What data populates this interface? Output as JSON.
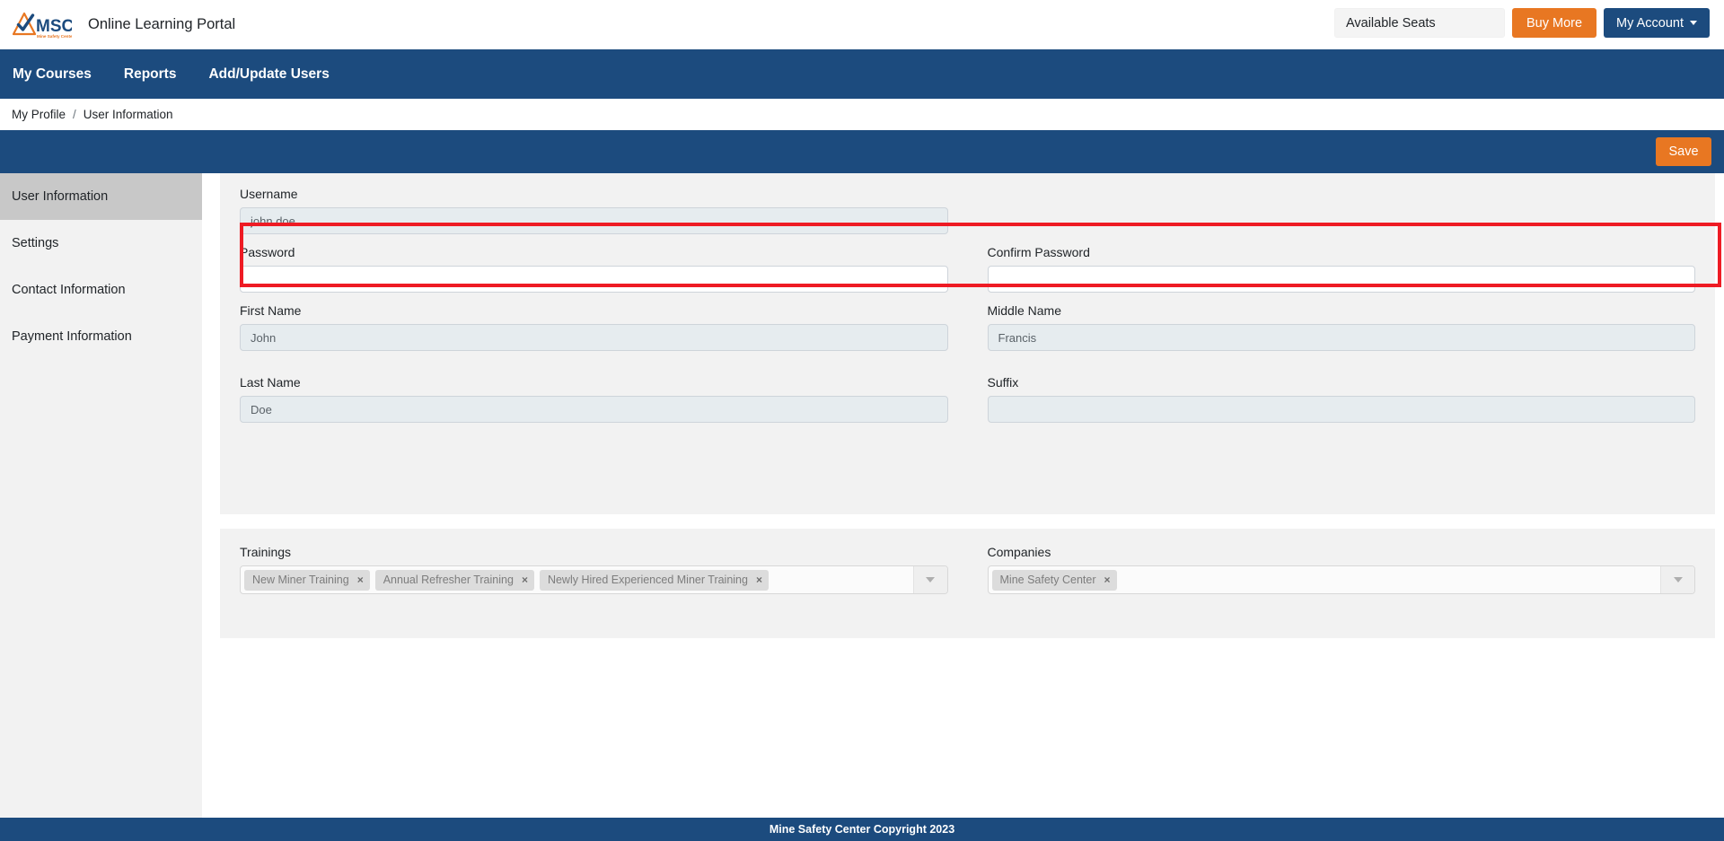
{
  "header": {
    "logo_text": "MSC",
    "logo_subtext": "Mine Safety Center",
    "logo_icon": "msc-triangle-check-logo",
    "app_title": "Online Learning Portal",
    "available_seats_label": "Available Seats",
    "buy_more_label": "Buy More",
    "my_account_label": "My Account",
    "caret_icon": "chevron-down-icon"
  },
  "nav": {
    "items": [
      {
        "label": "My Courses"
      },
      {
        "label": "Reports"
      },
      {
        "label": "Add/Update Users"
      }
    ]
  },
  "breadcrumb": {
    "parent": "My Profile",
    "separator": "/",
    "current": "User Information"
  },
  "action_bar": {
    "save_label": "Save"
  },
  "sidebar": {
    "items": [
      {
        "label": "User Information",
        "active": true
      },
      {
        "label": "Settings",
        "active": false
      },
      {
        "label": "Contact Information",
        "active": false
      },
      {
        "label": "Payment Information",
        "active": false
      }
    ]
  },
  "form": {
    "username": {
      "label": "Username",
      "value": "john.doe",
      "placeholder": ""
    },
    "password": {
      "label": "Password",
      "value": "",
      "placeholder": ""
    },
    "confirm_password": {
      "label": "Confirm Password",
      "value": "",
      "placeholder": ""
    },
    "first_name": {
      "label": "First Name",
      "value": "John",
      "placeholder": ""
    },
    "middle_name": {
      "label": "Middle Name",
      "value": "Francis",
      "placeholder": ""
    },
    "last_name": {
      "label": "Last Name",
      "value": "Doe",
      "placeholder": ""
    },
    "suffix": {
      "label": "Suffix",
      "value": "",
      "placeholder": ""
    }
  },
  "associations": {
    "trainings": {
      "label": "Trainings",
      "tags": [
        {
          "label": "New Miner Training",
          "remove_icon": "×"
        },
        {
          "label": "Annual Refresher Training",
          "remove_icon": "×"
        },
        {
          "label": "Newly Hired Experienced Miner Training",
          "remove_icon": "×"
        }
      ]
    },
    "companies": {
      "label": "Companies",
      "tags": [
        {
          "label": "Mine Safety Center",
          "remove_icon": "×"
        }
      ]
    }
  },
  "footer": {
    "text": "Mine Safety Center Copyright 2023"
  },
  "colors": {
    "brand_navy": "#1c4b7e",
    "brand_orange": "#e87722",
    "highlight_red": "#ee1b24",
    "panel_gray": "#f2f2f2",
    "sidebar_active": "#c8c8c8"
  }
}
